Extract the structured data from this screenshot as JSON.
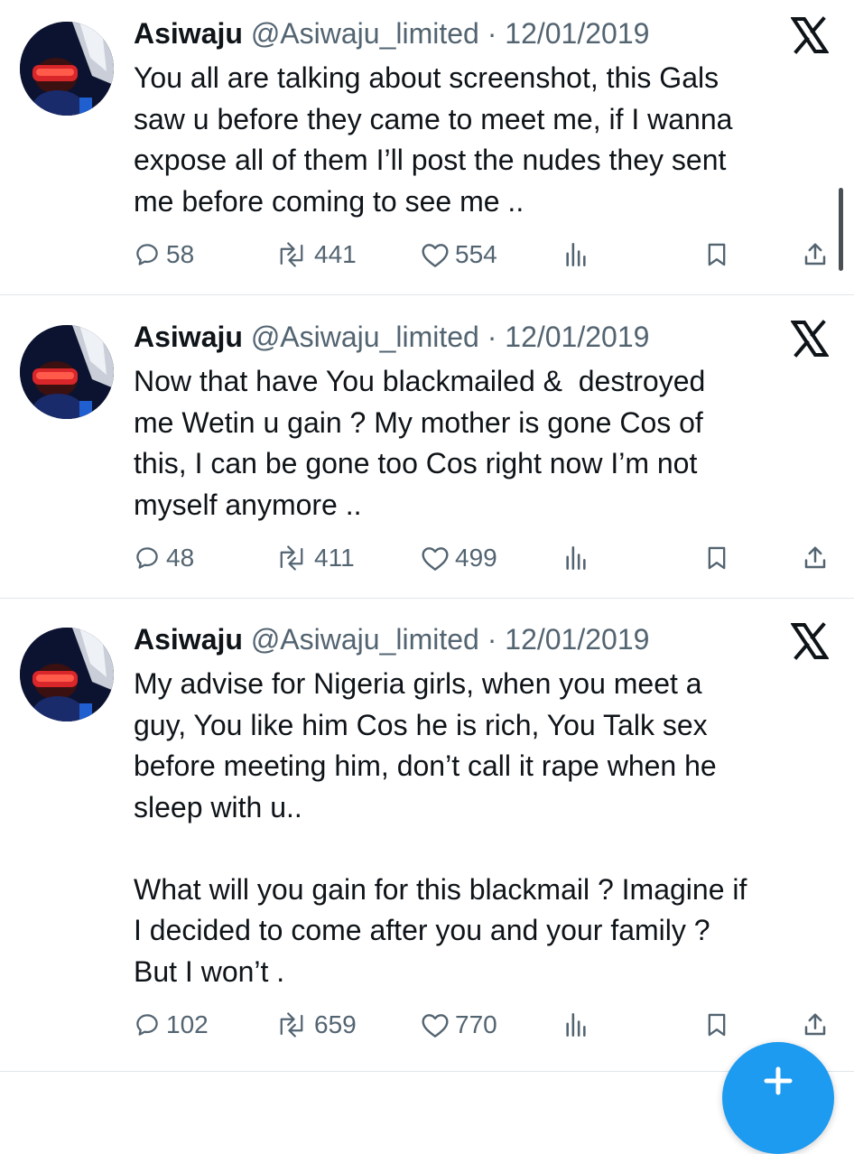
{
  "tweets": [
    {
      "name": "Asiwaju",
      "handle": "@Asiwaju_limited",
      "date": "· 12/01/2019",
      "text": "You all are talking about screenshot, this Gals\nsaw u before they came to meet me, if I wanna\nexpose all of them I’ll post the nudes they sent\nme before coming to see me ..",
      "replies": "58",
      "retweets": "441",
      "likes": "554"
    },
    {
      "name": "Asiwaju",
      "handle": "@Asiwaju_limited",
      "date": "· 12/01/2019",
      "text": "Now that have You blackmailed &  destroyed\nme Wetin u gain ? My mother is gone Cos of\nthis, I can be gone too Cos right now I’m not\nmyself anymore ..",
      "replies": "48",
      "retweets": "411",
      "likes": "499"
    },
    {
      "name": "Asiwaju",
      "handle": "@Asiwaju_limited",
      "date": "· 12/01/2019",
      "text": "My advise for Nigeria girls, when you meet a\nguy, You like him Cos he is rich, You Talk sex\nbefore meeting him, don’t call it rape when he\nsleep with u..\n\nWhat will you gain for this blackmail ? Imagine if\nI decided to come after you and your family ?\nBut I won’t .",
      "replies": "102",
      "retweets": "659",
      "likes": "770"
    }
  ],
  "icons": {
    "reply": "reply-icon",
    "retweet": "retweet-icon",
    "like": "heart-icon",
    "views": "views-icon",
    "bookmark": "bookmark-icon",
    "share": "share-icon",
    "platform": "x-logo-icon",
    "compose": "compose-fab"
  },
  "colors": {
    "text": "#0f1419",
    "secondary": "#536471",
    "divider": "#e1e6ea",
    "accent": "#1d9bf0"
  }
}
